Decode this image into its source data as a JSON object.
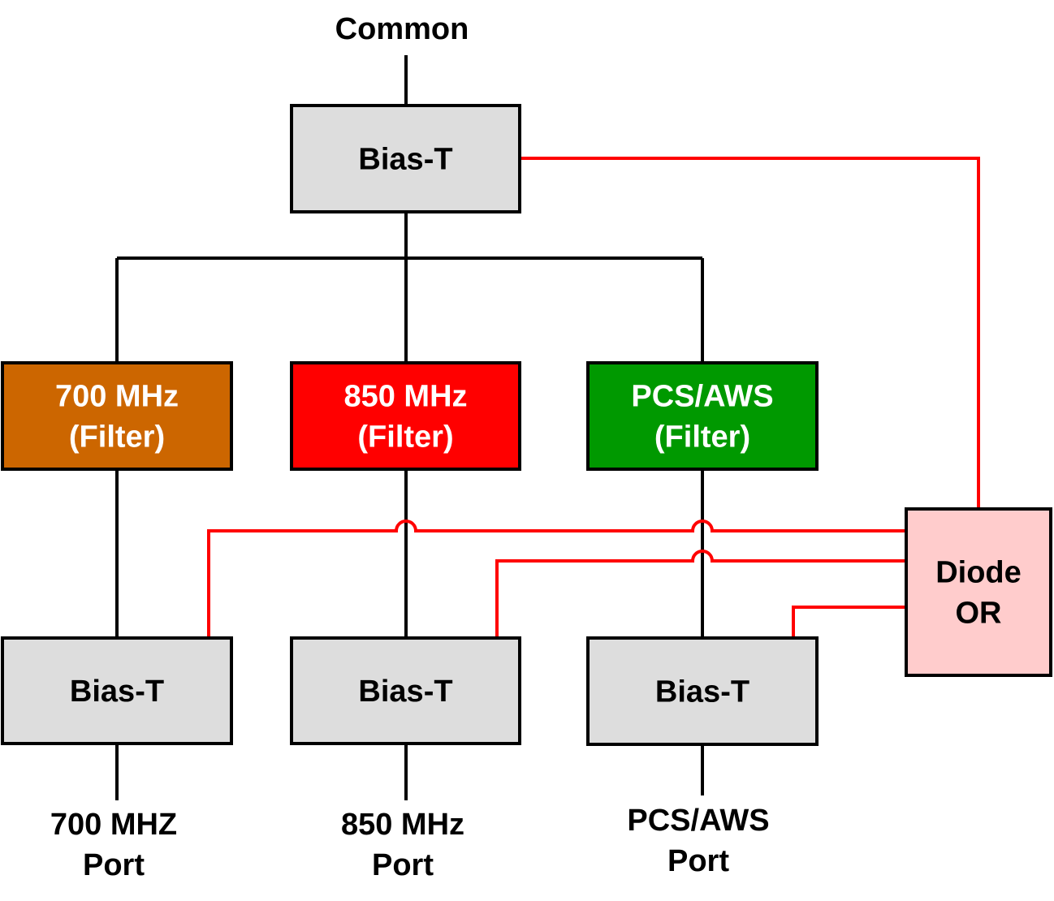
{
  "labels": {
    "common": "Common",
    "port_700": [
      "700 MHZ",
      "Port"
    ],
    "port_850": [
      "850 MHz",
      "Port"
    ],
    "port_pcs": [
      "PCS/AWS",
      "Port"
    ]
  },
  "blocks": {
    "bias_top": {
      "lines": [
        "Bias-T"
      ],
      "fill": "#DDDDDD",
      "text_color": "#000000"
    },
    "filter_700": {
      "lines": [
        "700 MHz",
        "(Filter)"
      ],
      "fill": "#CC6600",
      "text_color": "#FFFFFF"
    },
    "filter_850": {
      "lines": [
        "850 MHz",
        "(Filter)"
      ],
      "fill": "#FF0000",
      "text_color": "#FFFFFF"
    },
    "filter_pcs": {
      "lines": [
        "PCS/AWS",
        "(Filter)"
      ],
      "fill": "#009900",
      "text_color": "#FFFFFF"
    },
    "bias_700": {
      "lines": [
        "Bias-T"
      ],
      "fill": "#DDDDDD",
      "text_color": "#000000"
    },
    "bias_850": {
      "lines": [
        "Bias-T"
      ],
      "fill": "#DDDDDD",
      "text_color": "#000000"
    },
    "bias_pcs": {
      "lines": [
        "Bias-T"
      ],
      "fill": "#DDDDDD",
      "text_color": "#000000"
    },
    "diode_or": {
      "lines": [
        "Diode",
        "OR"
      ],
      "fill": "#FFCCCC",
      "text_color": "#000000"
    }
  },
  "colors": {
    "rf_line": "#000000",
    "dc_line": "#FF0000"
  }
}
